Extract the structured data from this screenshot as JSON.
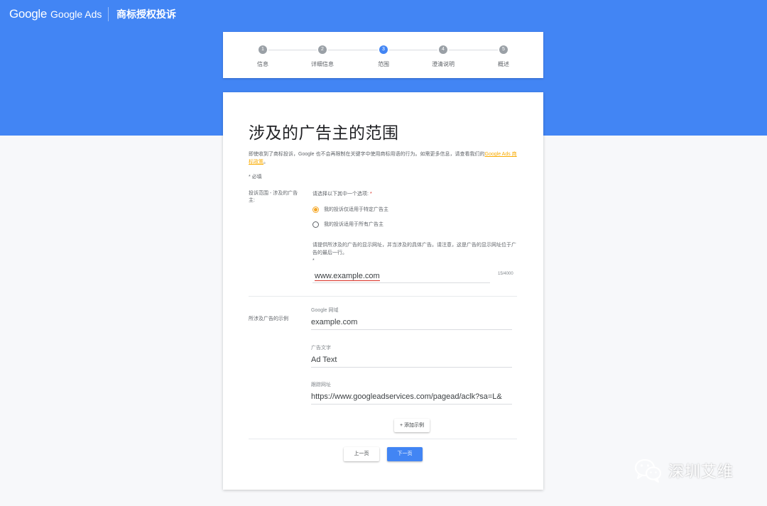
{
  "header": {
    "logo_google": "Google",
    "logo_ads": "Google Ads",
    "page_title": "商标授权投诉"
  },
  "stepper": {
    "steps": [
      {
        "number": "1",
        "label": "信息"
      },
      {
        "number": "2",
        "label": "详细信息"
      },
      {
        "number": "3",
        "label": "范围"
      },
      {
        "number": "4",
        "label": "澄清说明"
      },
      {
        "number": "5",
        "label": "概述"
      }
    ],
    "active_step": 3
  },
  "form": {
    "title": "涉及的广告主的范围",
    "intro_text": "即使收到了商标投诉，Google 也不会再限制在关键字中使用商标用语的行为。如需更多信息，请查看我们的",
    "intro_link": "Google Ads 商标政策",
    "intro_end": "。",
    "required_note": "* 必填",
    "scope_label": "投诉范围 - 涉及的广告主:",
    "scope_prompt": "请选择以下其中一个选项:",
    "scope_required_mark": "*",
    "options": [
      {
        "label": "我的投诉仅适用于特定广告主",
        "selected": true
      },
      {
        "label": "我的投诉适用于所有广告主",
        "selected": false
      }
    ],
    "url_hint": "请提供所涉及的广告的显示网址，并当涉及的具体广告。请注意，这是广告的显示网址位于广告的最后一行。",
    "url_hint_mark": "*",
    "url_value": "www.example.com",
    "url_counter": "15/4000",
    "examples_label": "所涉及广告的示例",
    "domain_label": "Google 网域",
    "domain_value": "example.com",
    "adtext_label": "广告文字",
    "adtext_value": "Ad Text",
    "trackurl_label": "跟踪网址",
    "trackurl_value": "https://www.googleadservices.com/pagead/aclk?sa=L&",
    "add_example": "+ 添加示例",
    "prev_button": "上一页",
    "next_button": "下一页"
  },
  "watermark": {
    "text": "深圳艾维",
    "icon": "wechat-icon"
  },
  "colors": {
    "brand_blue": "#4285f4",
    "accent_orange": "#f5a623",
    "link_orange": "#f9ab00",
    "required_red": "#d93025"
  }
}
